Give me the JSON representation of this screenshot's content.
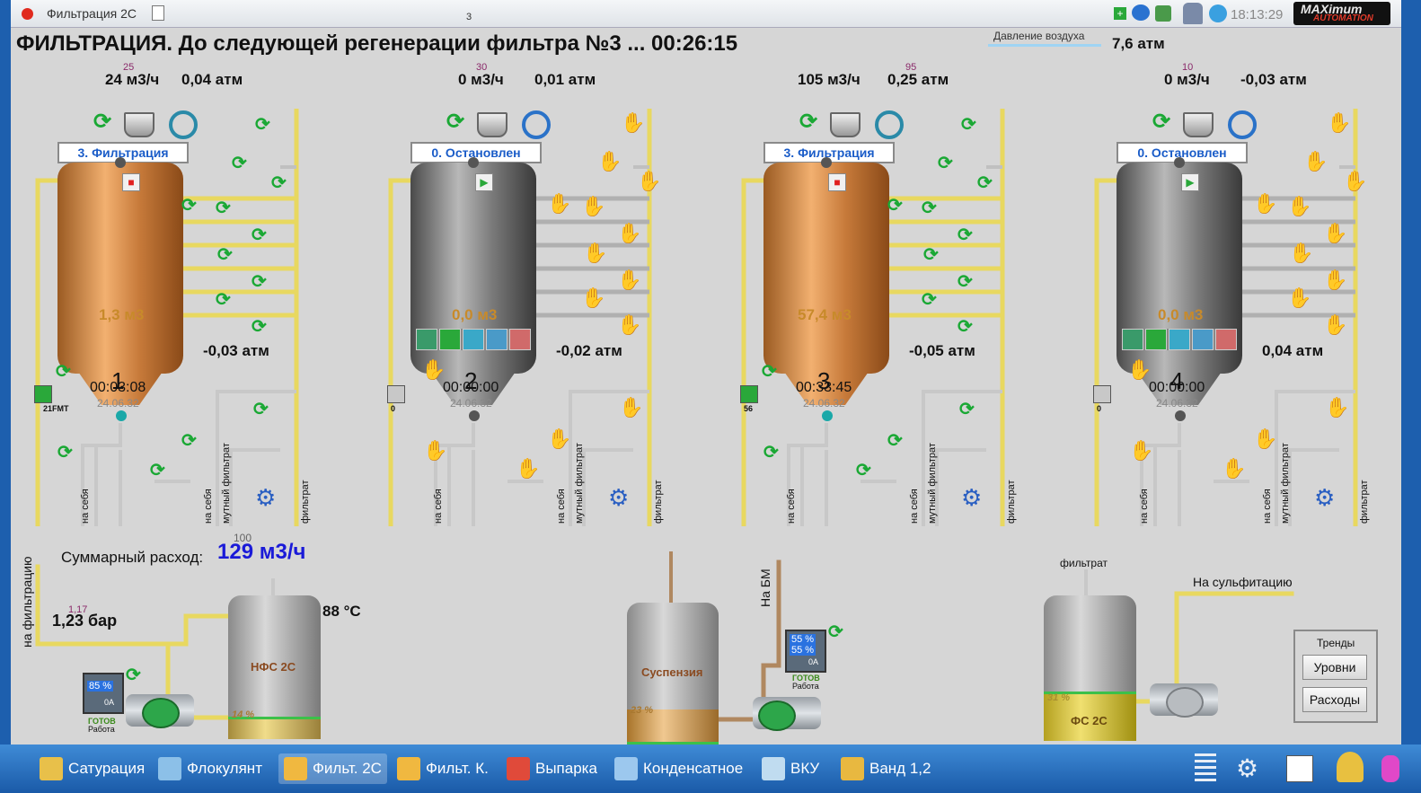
{
  "window": {
    "title": "Фильтрация 2С",
    "center_mark": "3",
    "clock": "18:13:29",
    "logo_top": "MAXimum",
    "logo_bottom": "AUTOMATION"
  },
  "header": {
    "title": "ФИЛЬТРАЦИЯ. До следующей регенерации фильтра №3 ... 00:26:15",
    "air_label": "Давление воздуха",
    "air_value": "7,6 атм"
  },
  "filters": [
    {
      "num": "1",
      "small": "25",
      "flow": "24 м3/ч",
      "pressure": "0,04 атм",
      "status": "3. Фильтрация",
      "volume": "1,3 м3",
      "bottom_pressure": "-0,03 атм",
      "timer": "00:03:08",
      "date": "24.06.32",
      "tag": "21FMT",
      "active": true
    },
    {
      "num": "2",
      "small": "30",
      "flow": "0 м3/ч",
      "pressure": "0,01 атм",
      "status": "0. Остановлен",
      "volume": "0,0 м3",
      "bottom_pressure": "-0,02 атм",
      "timer": "00:00:00",
      "date": "24.06.32",
      "tag": "0",
      "active": false
    },
    {
      "num": "3",
      "small": "95",
      "flow": "105 м3/ч",
      "pressure": "0,25 атм",
      "status": "3. Фильтрация",
      "volume": "57,4 м3",
      "bottom_pressure": "-0,05 атм",
      "timer": "00:33:45",
      "date": "24.06.32",
      "tag": "56",
      "active": true
    },
    {
      "num": "4",
      "small": "10",
      "flow": "0 м3/ч",
      "pressure": "-0,03 атм",
      "status": "0. Остановлен",
      "volume": "0,0 м3",
      "bottom_pressure": "0,04 атм",
      "timer": "00:00:00",
      "date": "24.06.32",
      "tag": "0",
      "active": false
    }
  ],
  "pipe_labels": {
    "self": "на себя",
    "turbid": "мутный фильтрат",
    "filtrate": "фильтрат"
  },
  "bottom": {
    "total_label": "Суммарный расход:",
    "total_small": "100",
    "total_value": "129 м3/ч",
    "to_filtration": "на фильтрацию",
    "pressure_small": "1,17",
    "pressure_value": "1,23 бар",
    "nfs_label": "НФС 2С",
    "nfs_temp": "88 °C",
    "nfs_level": "14 %",
    "pump1_pct": "85 %",
    "pump1_amp": "0A",
    "pump1_ready": "ГОТОВ",
    "pump1_work": "Работа",
    "susp_label": "Суспензия",
    "susp_level": "23 %",
    "to_bm": "На БМ",
    "pump2_pct1": "55 %",
    "pump2_pct2": "55 %",
    "pump2_amp": "0A",
    "pump2_ready": "ГОТОВ",
    "pump2_work": "Работа",
    "filtrate_label": "фильтрат",
    "fs_label": "ФС 2С",
    "fs_level": "31 %",
    "to_sulf": "На сульфитацию",
    "trends_title": "Тренды",
    "levels_btn": "Уровни",
    "flows_btn": "Расходы"
  },
  "taskbar": [
    {
      "label": "Сатурация",
      "color": "#e8c04a"
    },
    {
      "label": "Флокулянт",
      "color": "#8cc0e8"
    },
    {
      "label": "Фильт. 2С",
      "color": "#f0b840"
    },
    {
      "label": "Фильт. К.",
      "color": "#f0b840"
    },
    {
      "label": "Выпарка",
      "color": "#e04a3a"
    },
    {
      "label": "Конденсатное",
      "color": "#9cc8ee"
    },
    {
      "label": "ВКУ",
      "color": "#c0dcf0"
    },
    {
      "label": "Ванд 1,2",
      "color": "#e8b840"
    }
  ]
}
